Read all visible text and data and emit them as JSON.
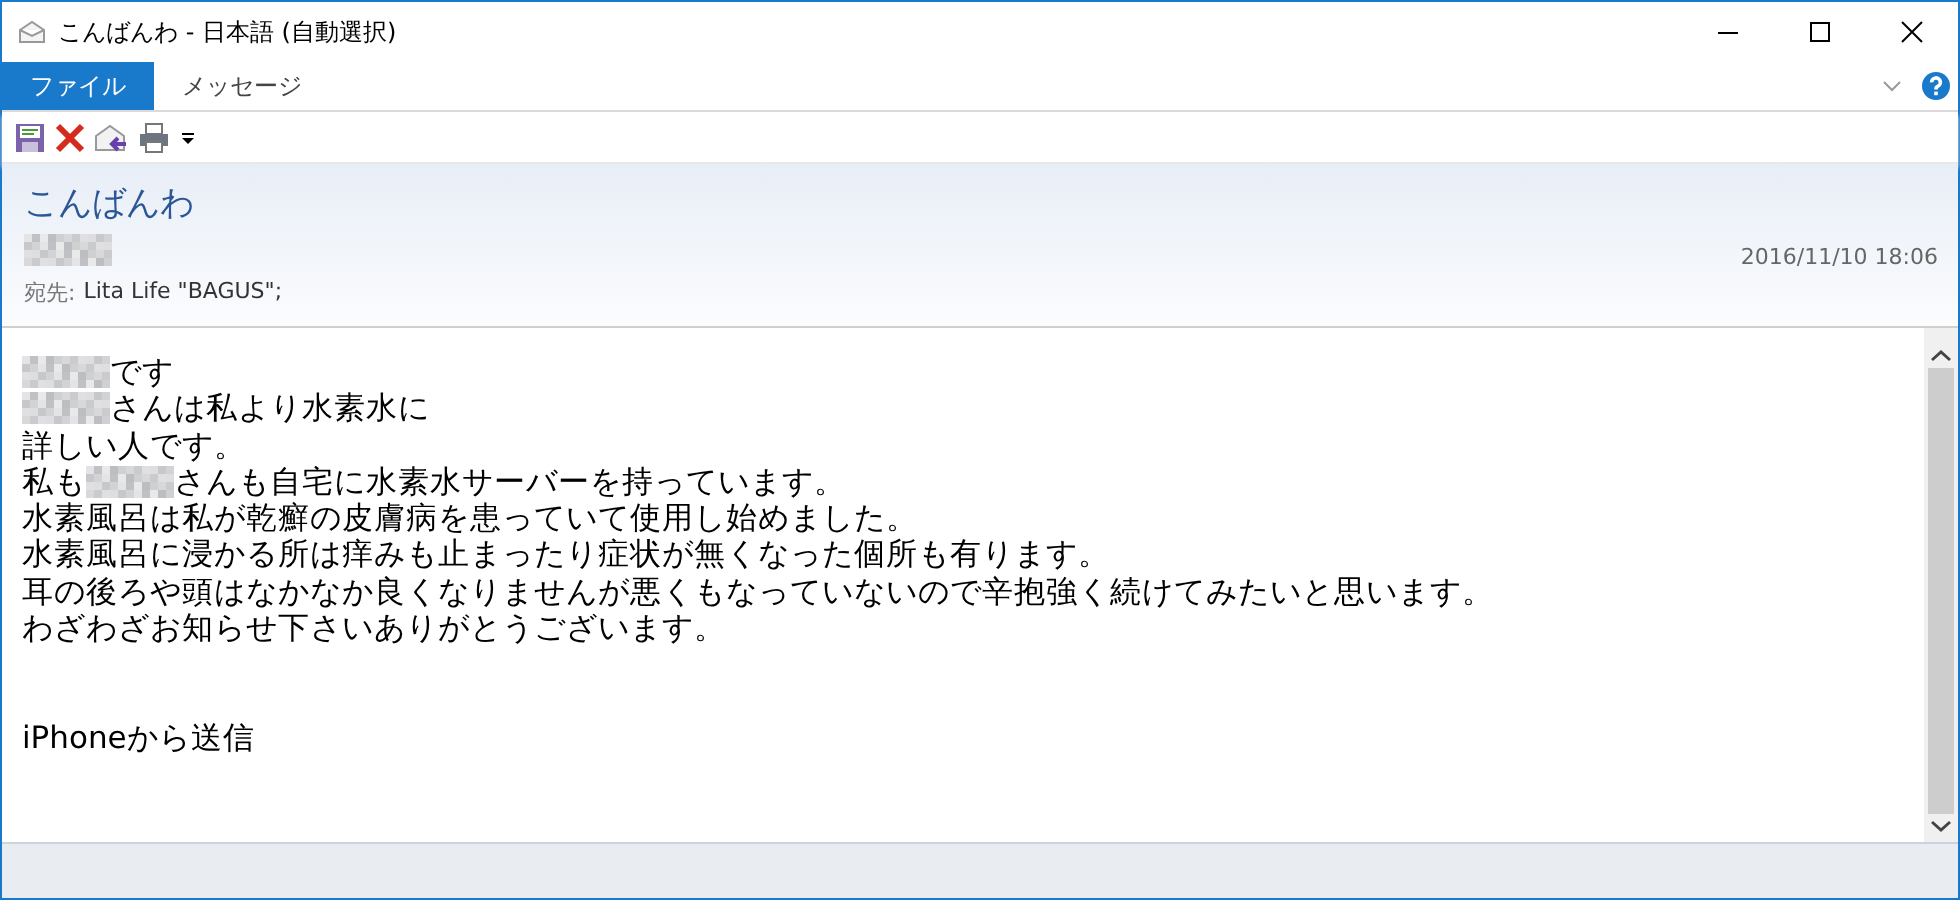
{
  "window": {
    "title": "こんばんわ - 日本語 (自動選択)"
  },
  "ribbon_tabs": [
    {
      "label": "ファイル",
      "selected": true
    },
    {
      "label": "メッセージ",
      "selected": false
    }
  ],
  "message": {
    "subject": "こんばんわ",
    "sender_redacted": true,
    "date": "2016/11/10 18:06",
    "to_label": "宛先:",
    "to": "Lita Life \"BAGUS\";",
    "body": [
      [
        {
          "kind": "redacted"
        },
        {
          "kind": "text",
          "text": "です"
        }
      ],
      [
        {
          "kind": "redacted"
        },
        {
          "kind": "text",
          "text": "さんは私より水素水に"
        }
      ],
      [
        {
          "kind": "text",
          "text": "詳しい人です。"
        }
      ],
      [
        {
          "kind": "text",
          "text": "私も"
        },
        {
          "kind": "redacted"
        },
        {
          "kind": "text",
          "text": "さんも自宅に水素水サーバーを持っています。"
        }
      ],
      [
        {
          "kind": "text",
          "text": "水素風呂は私が乾癬の皮膚病を患っていて使用し始めました。"
        }
      ],
      [
        {
          "kind": "text",
          "text": "水素風呂に浸かる所は痒みも止まったり症状が無くなった個所も有ります。"
        }
      ],
      [
        {
          "kind": "text",
          "text": "耳の後ろや頭はなかなか良くなりませんが悪くもなっていないので辛抱強く続けてみたいと思います。"
        }
      ],
      [
        {
          "kind": "text",
          "text": "わざわざお知らせ下さいありがとうございます。"
        }
      ],
      [
        {
          "kind": "text",
          "text": "iPhoneから送信",
          "gap_before": true
        }
      ]
    ]
  }
}
